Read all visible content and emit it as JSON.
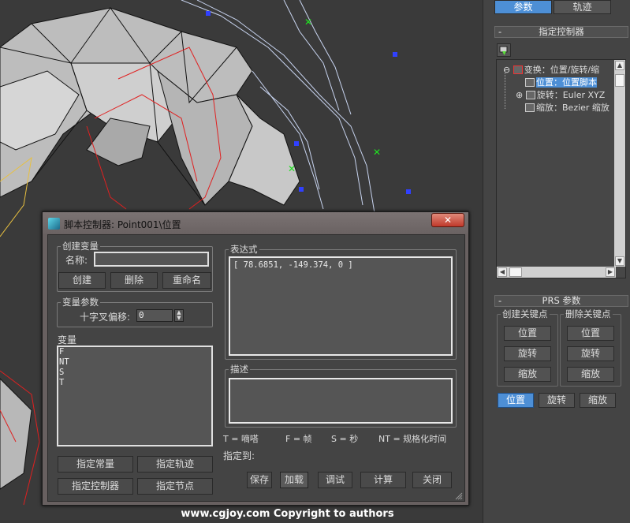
{
  "command_panel": {
    "tabs": [
      "参数",
      "轨迹"
    ],
    "active_tab": 0,
    "assign_controller": {
      "title": "指定控制器",
      "tree": [
        {
          "label": "变换：位置/旋转/缩",
          "prefix": "⊖",
          "selected": false
        },
        {
          "label": "位置：位置脚本",
          "prefix": "",
          "selected": true
        },
        {
          "label": "旋转：Euler XYZ",
          "prefix": "⊕",
          "selected": false
        },
        {
          "label": "缩放：Bezier 缩放",
          "prefix": "",
          "selected": false
        }
      ]
    },
    "prs": {
      "title": "PRS 参数",
      "create_key_label": "创建关键点",
      "delete_key_label": "删除关键点",
      "create_buttons": [
        "位置",
        "旋转",
        "缩放"
      ],
      "delete_buttons": [
        "位置",
        "旋转",
        "缩放"
      ],
      "mode_buttons": [
        "位置",
        "旋转",
        "缩放"
      ],
      "active_mode": 0
    }
  },
  "dialog": {
    "title": "脚本控制器: Point001\\位置",
    "close_label": "✕",
    "create_variable": {
      "group_label": "创建变量",
      "name_label": "名称:",
      "name_value": "",
      "buttons": [
        "创建",
        "删除",
        "重命名"
      ]
    },
    "variable_params": {
      "group_label": "变量参数",
      "offset_label": "十字叉偏移:",
      "offset_value": "0"
    },
    "variables": {
      "label": "变量",
      "items": [
        "F",
        "NT",
        "S",
        "T"
      ]
    },
    "bottom_left_buttons": [
      "指定常量",
      "指定轨迹",
      "指定控制器",
      "指定节点"
    ],
    "expression": {
      "group_label": "表达式",
      "value": "[ 78.6851, -149.374, 0 ]"
    },
    "description": {
      "group_label": "描述",
      "value": ""
    },
    "legend": [
      "T = 嘀嗒",
      "F = 帧",
      "S = 秒",
      "NT = 规格化时间"
    ],
    "assign_to_label": "指定到:",
    "action_buttons": [
      "保存",
      "加载",
      "调试",
      "计算",
      "关闭"
    ]
  },
  "watermark": "www.cgjoy.com  Copyright to authors",
  "colors": {
    "accent": "#4d8fd6",
    "close_red": "#c0392b"
  }
}
